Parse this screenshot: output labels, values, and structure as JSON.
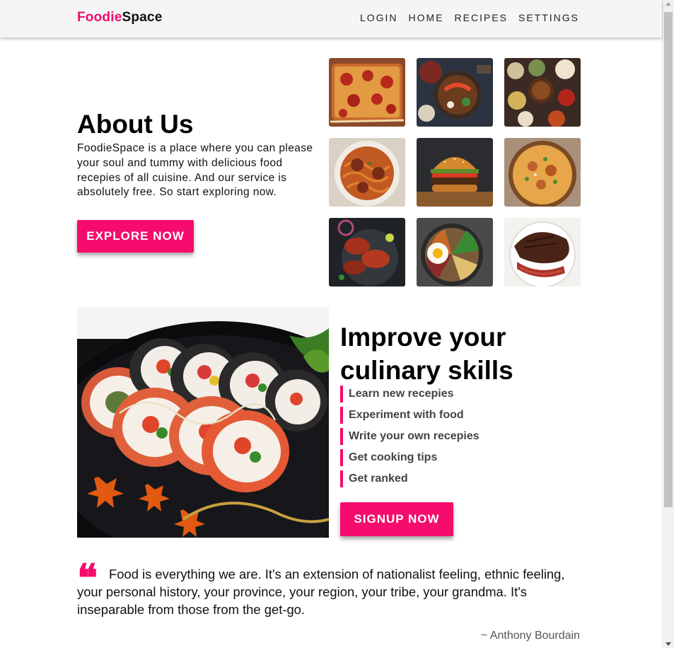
{
  "navbar": {
    "brand_part1": "Foodie",
    "brand_part2": "Space",
    "links": [
      "LOGIN",
      "HOME",
      "RECIPES",
      "SETTINGS"
    ]
  },
  "about": {
    "title": "About Us",
    "text": "FoodieSpace is a place where you can please your soul and tummy with delicious food recepies of all cuisine. And our service is absolutely free. So start exploring now.",
    "button": "EXPLORE NOW"
  },
  "gallery": {
    "items": [
      "pizza",
      "rice bowl",
      "table spread",
      "spaghetti meatballs",
      "burger",
      "biryani",
      "grilled chicken",
      "bibimbap",
      "steak"
    ]
  },
  "improve": {
    "title": "Improve your culinary skills",
    "items": [
      "Learn new recepies",
      "Experiment with food",
      "Write your own recepies",
      "Get cooking tips",
      "Get ranked"
    ],
    "button": "SIGNUP NOW"
  },
  "quote": {
    "mark": "❝",
    "text": "Food is everything we are. It's an extension of nationalist feeling, ethnic feeling, your personal history, your province, your region, your tribe, your grandma. It's inseparable from those from the get-go.",
    "author": "~ Anthony Bourdain"
  },
  "colors": {
    "accent": "#f50c6c",
    "navbar_bg": "#f5f5f5"
  }
}
